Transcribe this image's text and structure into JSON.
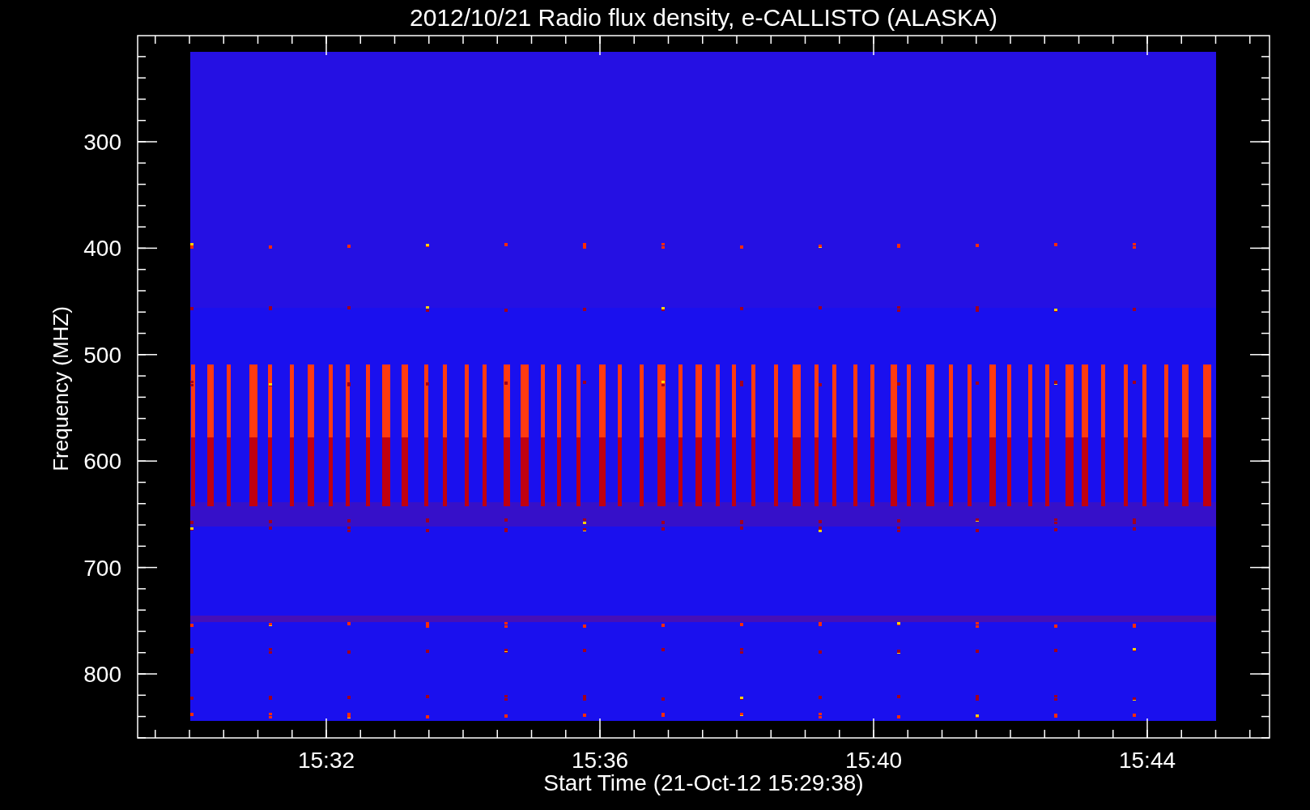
{
  "title": "2012/10/21  Radio flux density, e-CALLISTO (ALASKA)",
  "y_axis": {
    "label": "Frequency (MHZ)",
    "ticks": [
      "300",
      "400",
      "500",
      "600",
      "700",
      "800"
    ]
  },
  "x_axis": {
    "label": "Start Time (21-Oct-12 15:29:38)",
    "ticks": [
      "15:32",
      "15:36",
      "15:40",
      "15:44"
    ]
  }
}
